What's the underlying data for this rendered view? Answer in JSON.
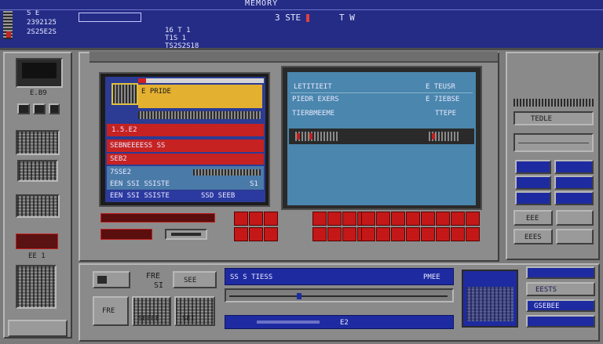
{
  "header": {
    "title": "MEMORY",
    "left_code_1": "S  E",
    "left_code_2": "2392125",
    "left_code_3": "2S25E2S",
    "left_code_4": "16 T  1",
    "left_code_5": "T1S  1",
    "left_code_6": "TS2S2S18",
    "center_code": "3  STE  :",
    "right_code": "T W",
    "accent": "#2a3190"
  },
  "left_panel": {
    "label": "E.B9",
    "small_label": "EE 1"
  },
  "red_screen": {
    "top_label": "E  PRIDE",
    "row_1": "1.5.E2",
    "row_2": "SEBNEEEESS  SS",
    "row_3": "SEB2",
    "row_4": "7SSE2",
    "row_5": "EEN  SSI  SSISTE",
    "right_value": "SSD  SEEB",
    "corner_value": "S1"
  },
  "blue_screen": {
    "title_left": "LETITIEIT",
    "title_right": "E  TEUSR",
    "row_1_left": "PIEDR  EXERS",
    "row_1_right": "E  7IEBSE",
    "row_2_left": "TIERBMEEME",
    "row_2_right": "TTEPE",
    "bg": "#4a86ad"
  },
  "right_panel": {
    "label_1": "TEDLE",
    "label_2": "EEE",
    "label_3": "EEES"
  },
  "bottom": {
    "left_label_1": "FRE",
    "left_label_2": "SI",
    "left_label_3": "SEE",
    "left_label_4": "SEEEE",
    "left_label_5": "SEI",
    "bar_label_1": "SS  S  TIESS",
    "bar_label_2": "PMEE",
    "bar_label_3": "E2",
    "right_label_1": "EESTS",
    "right_label_2": "GSEBEE"
  }
}
